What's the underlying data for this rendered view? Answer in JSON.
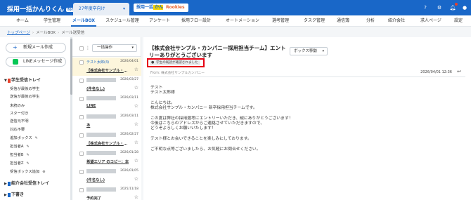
{
  "header": {
    "logo_main": "採用一括かんりくん",
    "logo_sub": "for 新卒",
    "year_tab": "27年度卒向け",
    "brand2_prefix": "採用一括",
    "brand2_highlight": "かんりくん",
    "brand2_tag": "中途",
    "brand3": "Rookies",
    "icons": [
      "help-icon",
      "settings-icon",
      "bell-icon",
      "user-menu-icon"
    ]
  },
  "nav": {
    "items": [
      "ホーム",
      "学生管理",
      "メールBOX",
      "スケジュール管理",
      "アンケート",
      "採用フロー設計",
      "オートメーション",
      "選考管理",
      "タスク管理",
      "通信簿",
      "分析",
      "紹介会社",
      "求人ページ",
      "設定"
    ],
    "active": "メールBOX"
  },
  "breadcrumb": {
    "home": "トップページ",
    "box": "メールBOX",
    "current": "メール送受信"
  },
  "sidebar": {
    "new_mail": "新規メール作成",
    "line_msg": "LINEメッセージ作成",
    "student_tray": "学生受信トレイ",
    "items": [
      {
        "label": "受信が最後の学生"
      },
      {
        "label": "送信が最後の学生"
      },
      {
        "label": "未読のみ"
      },
      {
        "label": "スター付き"
      },
      {
        "label": "送信元不明"
      },
      {
        "label": "対応不要"
      },
      {
        "label": "追加ボックス",
        "editable": true
      },
      {
        "label": "担当者A",
        "editable": true
      },
      {
        "label": "担当者B",
        "editable": true
      },
      {
        "label": "担当者Z",
        "editable": true
      },
      {
        "label": "受信ボックス追加",
        "addable": true
      }
    ],
    "agency_tray": "紹介会社受信トレイ",
    "drafts": "下書き"
  },
  "list": {
    "bulk_select": "一括操作",
    "rows": [
      {
        "from": "テスト太郎(4)",
        "date": "2026/04/01",
        "subject": "【株式会社サンプル・カンパ",
        "selected": true,
        "redacted": false
      },
      {
        "from": "",
        "date": "2026/03/27",
        "subject": "(件名なし)",
        "selected": false,
        "redacted": true
      },
      {
        "from": "",
        "date": "2026/03/11",
        "subject": "LINE",
        "selected": false,
        "redacted": true
      },
      {
        "from": "",
        "date": "2026/03/11",
        "subject": "あ",
        "selected": false,
        "redacted": true
      },
      {
        "from": "",
        "date": "2026/02/27",
        "subject": "【株式会社サンプル・カンパ",
        "selected": false,
        "redacted": true
      },
      {
        "from": "",
        "date": "2026/01/28",
        "subject": "希望エリア のコピー：本",
        "selected": false,
        "redacted": true
      },
      {
        "from": "",
        "date": "2026/01/05",
        "subject": "(件名なし)",
        "selected": false,
        "redacted": true
      },
      {
        "from": "",
        "date": "2025/11/18",
        "subject": "予約完了",
        "selected": false,
        "redacted": true
      }
    ]
  },
  "detail": {
    "title": "【株式会社サンプル・カンパニー採用担当チーム】エントリーありがとうございます",
    "box_move": "ボックス移動",
    "confirm_label": "学生の既読が確認されました",
    "from": "From: 株式会社サンプルカンパニー",
    "date": "2026/04/01 12:36",
    "body": [
      "テスト",
      "テスト太郎様",
      "",
      "こんにちは。",
      "株式会社サンプル・カンパニー 新卒採用担当チームです。",
      "",
      "この度は弊社の採用選考にエントリーいただき、誠にありがとうございます！",
      "今後はこちらのアドレスからご連絡させていただきますので、",
      "どうぞよろしくお願いいたします！",
      "",
      "テスト様とお会いできることを楽しみにしております。",
      "",
      "ご不明な点等ございましたら、お気軽にお問合せください。"
    ]
  },
  "colors": {
    "primary": "#1967c8",
    "highlight_border": "#e60012",
    "selected_row": "#fdf6dc",
    "line_green": "#06c755",
    "student_tray_marker": "#e8412b",
    "agency_tray_marker": "#1967c8",
    "drafts_marker": "#1967c8"
  }
}
